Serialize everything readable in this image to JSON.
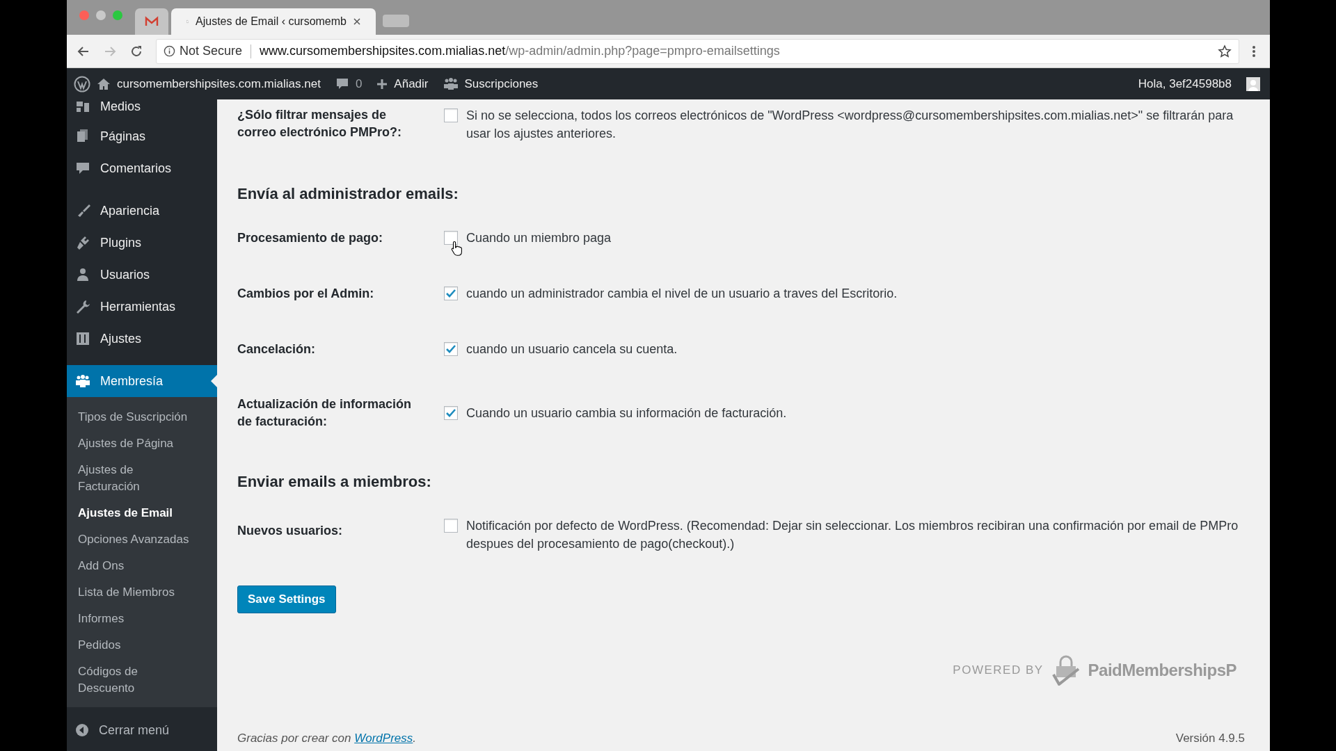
{
  "browser": {
    "tabs": [
      {
        "kind": "mail",
        "selected": false
      },
      {
        "kind": "page",
        "title": "Ajustes de Email ‹ cursomemb",
        "selected": true
      }
    ],
    "address": {
      "security": "Not Secure",
      "host": "www.cursomembershipsites.com.mialias.net",
      "path": "/wp-admin/admin.php?page=pmpro-emailsettings"
    }
  },
  "admin_bar": {
    "site": "cursomembershipsites.com.mialias.net",
    "comments": "0",
    "new": "Añadir",
    "subscriptions": "Suscripciones",
    "greeting": "Hola, 3ef24598b8"
  },
  "sidebar": {
    "items": [
      {
        "label": "Medios",
        "selected": false
      },
      {
        "label": "Páginas",
        "selected": false
      },
      {
        "label": "Comentarios",
        "selected": false
      },
      {
        "label": "Apariencia",
        "selected": false
      },
      {
        "label": "Plugins",
        "selected": false
      },
      {
        "label": "Usuarios",
        "selected": false
      },
      {
        "label": "Herramientas",
        "selected": false
      },
      {
        "label": "Ajustes",
        "selected": false
      },
      {
        "label": "Membresía",
        "selected": true
      }
    ],
    "submenu": [
      {
        "label": "Tipos de Suscripción",
        "selected": false
      },
      {
        "label": "Ajustes de Página",
        "selected": false
      },
      {
        "label": "Ajustes de Facturación",
        "selected": false
      },
      {
        "label": "Ajustes de Email",
        "selected": true
      },
      {
        "label": "Opciones Avanzadas",
        "selected": false
      },
      {
        "label": "Add Ons",
        "selected": false
      },
      {
        "label": "Lista de Miembros",
        "selected": false
      },
      {
        "label": "Informes",
        "selected": false
      },
      {
        "label": "Pedidos",
        "selected": false
      },
      {
        "label": "Códigos de Descuento",
        "selected": false
      }
    ],
    "collapse": "Cerrar menú"
  },
  "settings": [
    {
      "kind": "setting",
      "label": "¿Sólo filtrar mensajes de correo electrónico PMPro?:",
      "checked": false,
      "description": "Si no se selecciona, todos los correos electrónicos de \"WordPress <wordpress@cursomembershipsites.com.mialias.net>\" se filtrarán para usar los ajustes anteriores."
    },
    {
      "kind": "heading",
      "label": "Envía al administrador emails:"
    },
    {
      "kind": "setting",
      "label": "Procesamiento de pago:",
      "checked": false,
      "description": "Cuando un miembro paga"
    },
    {
      "kind": "setting",
      "label": "Cambios por el Admin:",
      "checked": true,
      "description": "cuando un administrador cambia el nivel de un usuario a traves del Escritorio."
    },
    {
      "kind": "setting",
      "label": "Cancelación:",
      "checked": true,
      "description": "cuando un usuario cancela su cuenta."
    },
    {
      "kind": "setting",
      "label": "Actualización de información de facturación:",
      "checked": true,
      "description": "Cuando un usuario cambia su información de facturación."
    },
    {
      "kind": "heading",
      "label": "Enviar emails a miembros:"
    },
    {
      "kind": "setting",
      "label": "Nuevos usuarios:",
      "checked": false,
      "description": "Notificación por defecto de WordPress. (Recomendad: Dejar sin seleccionar. Los miembros recibiran una confirmación por email de PMPro despues del procesamiento de pago(checkout).)"
    }
  ],
  "save_button": "Save Settings",
  "powered_by": {
    "label": "POWERED BY",
    "brand": "PaidMembershipsP"
  },
  "footer": {
    "thanks": "Gracias por crear con",
    "link": "WordPress",
    "period": ".",
    "version": "Versión 4.9.5"
  }
}
